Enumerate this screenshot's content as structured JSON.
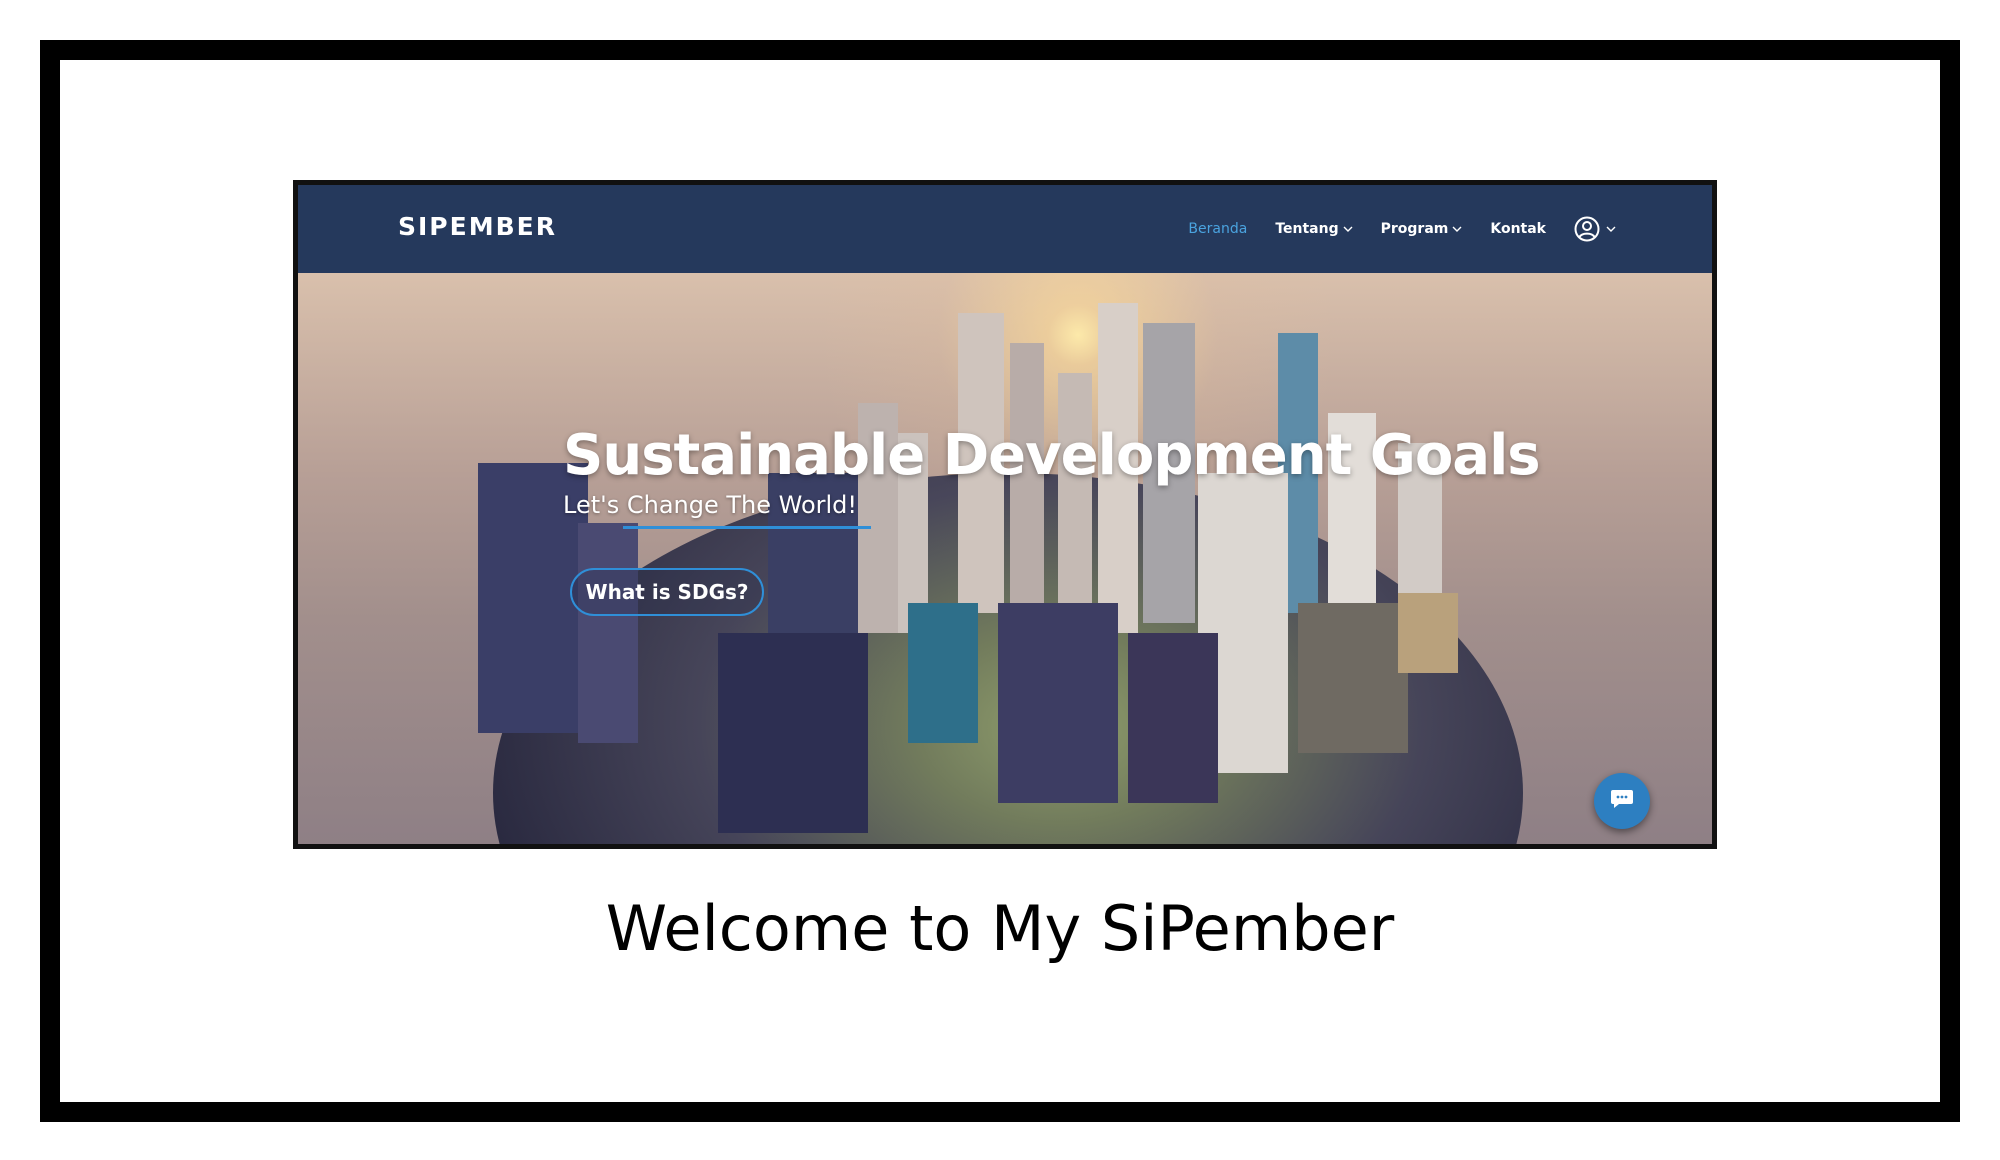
{
  "navbar": {
    "brand": "SIPEMBER",
    "items": [
      {
        "label": "Beranda",
        "has_dropdown": false,
        "active": true
      },
      {
        "label": "Tentang",
        "has_dropdown": true,
        "active": false
      },
      {
        "label": "Program",
        "has_dropdown": true,
        "active": false
      },
      {
        "label": "Kontak",
        "has_dropdown": false,
        "active": false
      }
    ],
    "chevron": "⌄",
    "user_icon": "user-circle-icon"
  },
  "hero": {
    "title": "Sustainable Development Goals",
    "subtitle": "Let's Change The World!",
    "cta_label": "What is SDGs?",
    "chat_icon": "chat-bubble-icon"
  },
  "caption": "Welcome to My SiPember",
  "colors": {
    "navbar_bg": "#25395c",
    "active_link": "#4aa3df",
    "accent_blue": "#2f8fd8",
    "chat_fab": "#2d7fc1",
    "frame_border": "#000000"
  }
}
